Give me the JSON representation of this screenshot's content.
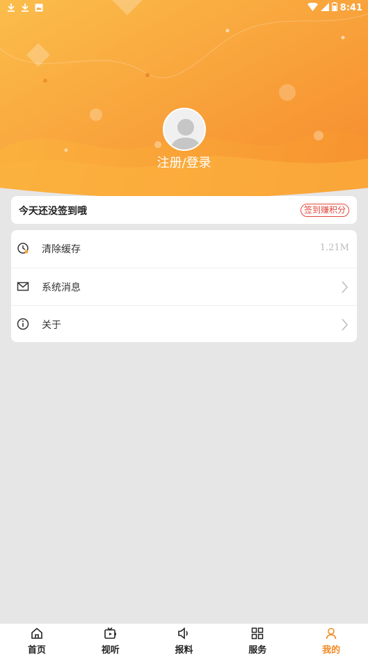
{
  "status_bar": {
    "time": "8:41"
  },
  "header": {
    "login_label": "注册/登录"
  },
  "checkin": {
    "title": "今天还没签到哦",
    "badge": "签到赚积分"
  },
  "menu": {
    "items": [
      {
        "label": "清除缓存",
        "value": "1.21M",
        "icon": "clock-icon"
      },
      {
        "label": "系统消息",
        "icon": "mail-icon"
      },
      {
        "label": "关于",
        "icon": "info-icon"
      }
    ]
  },
  "tabbar": {
    "tabs": [
      {
        "label": "首页",
        "icon": "home-icon"
      },
      {
        "label": "视听",
        "icon": "tv-icon"
      },
      {
        "label": "报料",
        "icon": "speaker-icon"
      },
      {
        "label": "服务",
        "icon": "grid-icon"
      },
      {
        "label": "我的",
        "icon": "person-icon",
        "active": true
      }
    ]
  },
  "colors": {
    "accent": "#f28a25",
    "header_top": "#fbb948",
    "header_bottom": "#f6902e",
    "badge": "#e0463b",
    "background": "#e6e6e6"
  }
}
